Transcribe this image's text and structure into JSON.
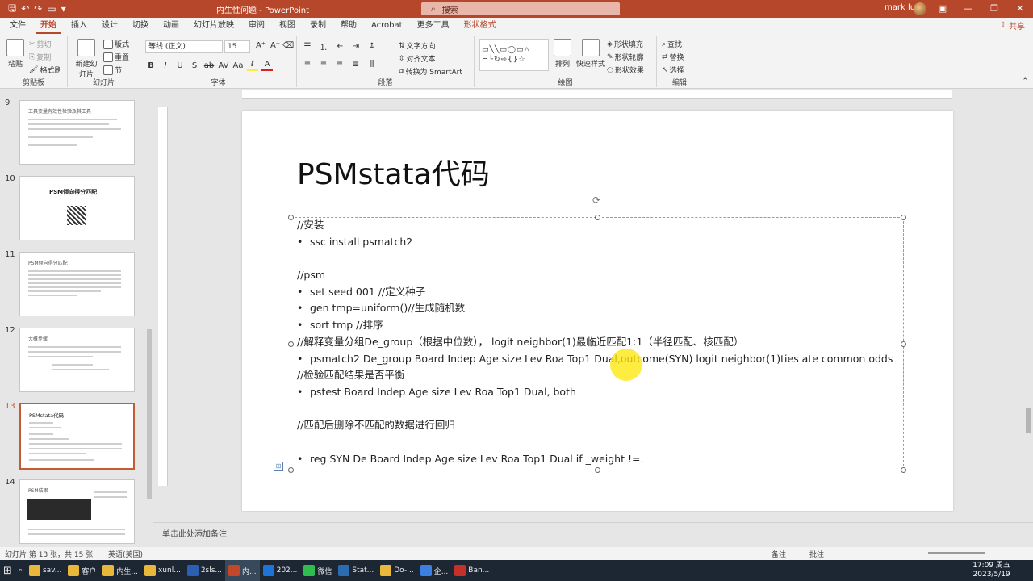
{
  "app": {
    "title": "内生性问题 - PowerPoint",
    "search_placeholder": "搜索",
    "user": "mark lu",
    "share": "共享"
  },
  "menu": {
    "tabs": [
      "文件",
      "开始",
      "插入",
      "设计",
      "切换",
      "动画",
      "幻灯片放映",
      "审阅",
      "视图",
      "录制",
      "帮助",
      "Acrobat",
      "更多工具",
      "形状格式"
    ]
  },
  "ribbon": {
    "clipboard": {
      "paste": "粘贴",
      "cut": "剪切",
      "copy": "复制",
      "format_painter": "格式刷",
      "label": "剪贴板"
    },
    "slides": {
      "new_slide": "新建幻灯片",
      "layout": "版式",
      "reset": "重置",
      "section": "节",
      "label": "幻灯片"
    },
    "font": {
      "font_name": "等线 (正文)",
      "font_size": "15",
      "label": "字体"
    },
    "paragraph": {
      "text_direction": "文字方向",
      "align_text": "对齐文本",
      "smartart": "转换为 SmartArt",
      "label": "段落"
    },
    "drawing": {
      "arrange": "排列",
      "quick_styles": "快速样式",
      "shape_fill": "形状填充",
      "shape_outline": "形状轮廓",
      "shape_effects": "形状效果",
      "label": "绘图"
    },
    "editing": {
      "find": "查找",
      "replace": "替换",
      "select": "选择",
      "label": "编辑"
    }
  },
  "thumbnails": [
    {
      "num": "9",
      "title": "工具变量有效性检验及其工具"
    },
    {
      "num": "10",
      "title": "PSM倾向得分匹配"
    },
    {
      "num": "11",
      "title": "PSM倾向得分匹配"
    },
    {
      "num": "12",
      "title": "大概步骤"
    },
    {
      "num": "13",
      "title": "PSMstata代码"
    },
    {
      "num": "14",
      "title": "PSM结果"
    }
  ],
  "slide": {
    "title": "PSMstata代码",
    "lines": [
      {
        "bullet": false,
        "text": "//安装"
      },
      {
        "bullet": true,
        "text": "ssc install psmatch2"
      },
      {
        "bullet": false,
        "text": ""
      },
      {
        "bullet": false,
        "text": "//psm"
      },
      {
        "bullet": true,
        "text": "set seed 001 //定义种子"
      },
      {
        "bullet": true,
        "text": "gen tmp=uniform()//生成随机数"
      },
      {
        "bullet": true,
        "text": "sort tmp //排序"
      },
      {
        "bullet": false,
        "text": "//解释变量分组De_group（根据中位数）， logit neighbor(1)最临近匹配1:1（半径匹配、核匹配）"
      },
      {
        "bullet": true,
        "text": "psmatch2 De_group Board Indep Age size Lev Roa Top1 Dual,outcome(SYN) logit neighbor(1)ties ate common odds"
      },
      {
        "bullet": false,
        "text": "//检验匹配结果是否平衡"
      },
      {
        "bullet": true,
        "text": "pstest Board Indep Age size Lev Roa Top1 Dual, both"
      },
      {
        "bullet": false,
        "text": ""
      },
      {
        "bullet": false,
        "text": "//匹配后删除不匹配的数据进行回归"
      },
      {
        "bullet": false,
        "text": ""
      },
      {
        "bullet": true,
        "text": "reg SYN De Board Indep Age size Lev Roa Top1 Dual if _weight !=."
      }
    ]
  },
  "notes": {
    "placeholder": "单击此处添加备注"
  },
  "status": {
    "slide_info": "幻灯片 第 13 张，共 15 张",
    "language": "英语(美国)",
    "notes": "备注",
    "comments": "批注"
  },
  "taskbar": {
    "items": [
      "sav...",
      "客户",
      "内生...",
      "xunl...",
      "2sls...",
      "内...",
      "202...",
      "微信",
      "Stat...",
      "Do-...",
      "企...",
      "Ban..."
    ],
    "time": "17:09 周五",
    "date": "2023/5/19"
  },
  "colors": {
    "accent": "#b7472a",
    "pointer": "#ffe600"
  }
}
